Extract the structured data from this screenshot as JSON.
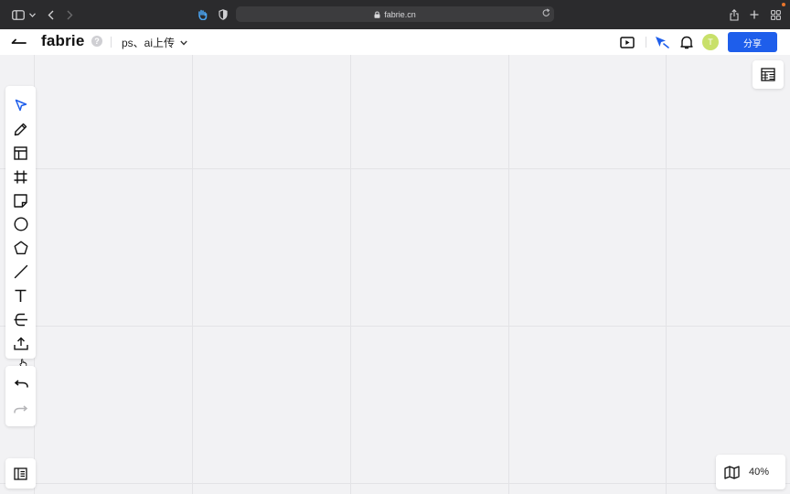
{
  "browser": {
    "url": "fabrie.cn",
    "icons": [
      "sidebar-icon",
      "chevron-down-icon",
      "back-arrow-icon",
      "forward-arrow-icon",
      "extension-hand-icon",
      "shield-icon",
      "lock-icon",
      "reload-icon",
      "share-icon",
      "new-tab-icon",
      "tab-overview-icon"
    ]
  },
  "header": {
    "logo": "fabrie",
    "help": "?",
    "doc_title": "ps、ai上传",
    "avatar_initial": "T",
    "share_label": "分享",
    "accent_color": "#1e5eeb"
  },
  "toolbar": {
    "tools": [
      "select-icon",
      "pen-icon",
      "template-icon",
      "frame-icon",
      "sticky-note-icon",
      "circle-icon",
      "pentagon-icon",
      "line-icon",
      "text-icon",
      "connector-icon",
      "upload-icon"
    ],
    "history": [
      "undo-icon",
      "redo-icon"
    ]
  },
  "zoom": {
    "value": "40%"
  }
}
